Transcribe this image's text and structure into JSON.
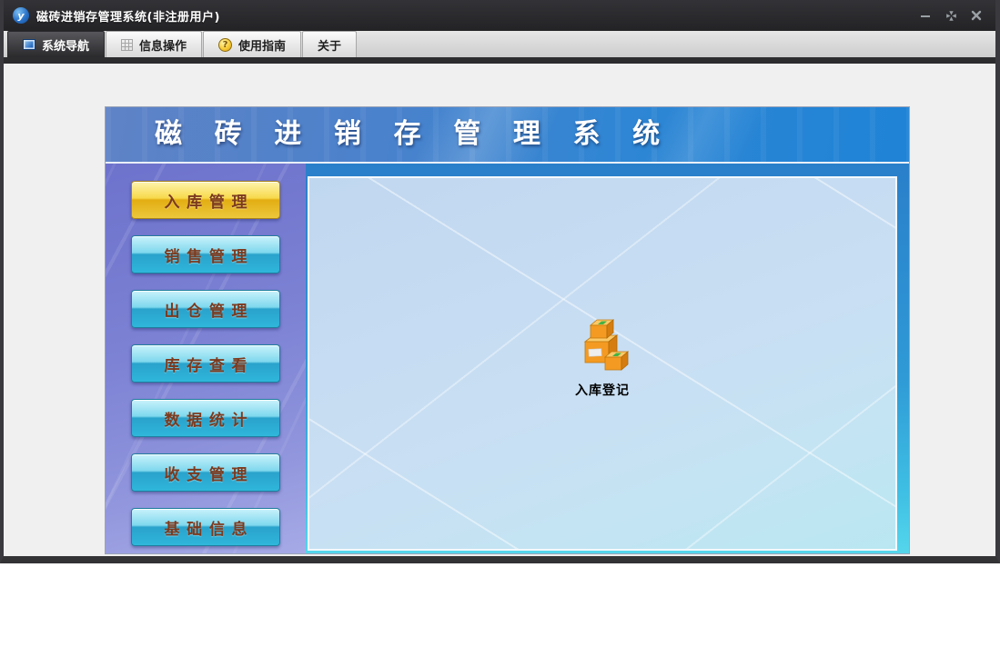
{
  "window": {
    "title": "磁砖进销存管理系统(非注册用户)",
    "app_icon": "y",
    "controls": {
      "minimize": "minimize",
      "restore": "restore",
      "close": "close"
    }
  },
  "tabs": [
    {
      "label": "系统导航",
      "icon": "monitor-icon",
      "selected": true
    },
    {
      "label": "信息操作",
      "icon": "grid-icon",
      "selected": false
    },
    {
      "label": "使用指南",
      "icon": "help-coin-icon",
      "selected": false
    },
    {
      "label": "关于",
      "icon": "none",
      "selected": false
    }
  ],
  "panel": {
    "header_title": "磁 砖 进 销 存 管 理 系 统",
    "sidebar_buttons": [
      {
        "label": "入库管理",
        "active": true
      },
      {
        "label": "销售管理",
        "active": false
      },
      {
        "label": "出仓管理",
        "active": false
      },
      {
        "label": "库存查看",
        "active": false
      },
      {
        "label": "数据统计",
        "active": false
      },
      {
        "label": "收支管理",
        "active": false
      },
      {
        "label": "基础信息",
        "active": false
      }
    ],
    "content": {
      "shortcut": {
        "label": "入库登记",
        "icon": "boxes-icon"
      }
    }
  },
  "colors": {
    "titlebar": "#2b2b2e",
    "header_blue": "#2a80cb",
    "sidebar_purple": "#7d82d4",
    "content_blue": "#c9dff3",
    "button_blue": "#2fb6da",
    "button_gold_active": "#e8b820",
    "button_text": "#7c3a1e"
  }
}
